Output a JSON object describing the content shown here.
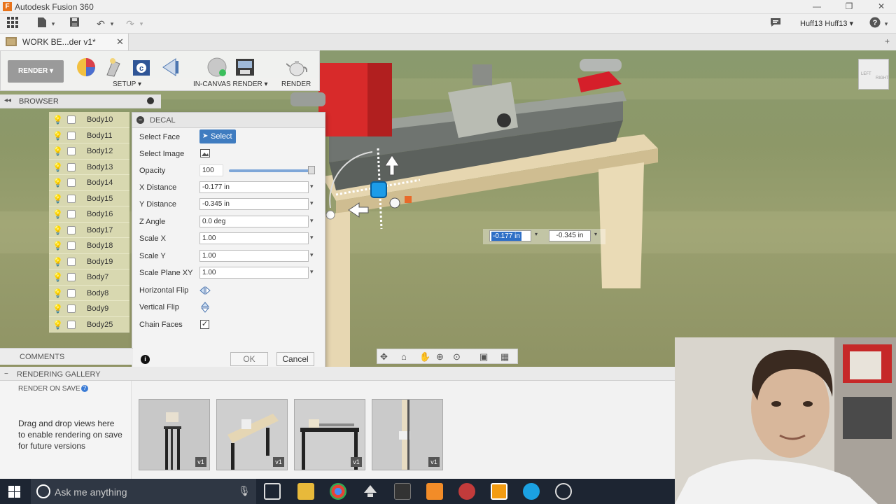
{
  "window": {
    "title": "Autodesk Fusion 360",
    "logo_letter": "F"
  },
  "app_toolbar": {
    "user": "Huff13 Huff13"
  },
  "document_tab": {
    "name": "WORK BE...der v1*"
  },
  "ribbon": {
    "workspace": "RENDER",
    "setup_label": "SETUP",
    "in_canvas_label": "IN-CANVAS RENDER",
    "render_label": "RENDER"
  },
  "browser": {
    "title": "BROWSER",
    "bodies": [
      "Body10",
      "Body11",
      "Body12",
      "Body13",
      "Body14",
      "Body15",
      "Body16",
      "Body17",
      "Body18",
      "Body19",
      "Body7",
      "Body8",
      "Body9",
      "Body25"
    ]
  },
  "decal": {
    "title": "DECAL",
    "select_face_label": "Select Face",
    "select_button": "Select",
    "select_image_label": "Select Image",
    "opacity_label": "Opacity",
    "opacity_value": "100",
    "x_distance_label": "X Distance",
    "x_distance_value": "-0.177 in",
    "y_distance_label": "Y Distance",
    "y_distance_value": "-0.345 in",
    "z_angle_label": "Z Angle",
    "z_angle_value": "0.0 deg",
    "scale_x_label": "Scale X",
    "scale_x_value": "1.00",
    "scale_y_label": "Scale Y",
    "scale_y_value": "1.00",
    "scale_plane_label": "Scale Plane XY",
    "scale_plane_value": "1.00",
    "hflip_label": "Horizontal Flip",
    "vflip_label": "Vertical Flip",
    "chain_faces_label": "Chain Faces",
    "ok": "OK",
    "cancel": "Cancel"
  },
  "canvas_inputs": {
    "x": "-0.177 in",
    "y": "-0.345 in"
  },
  "viewcube": {
    "face1": "LEFT",
    "face2": "RIGHT"
  },
  "comments": {
    "title": "COMMENTS"
  },
  "gallery": {
    "title": "RENDERING GALLERY",
    "render_on_save": "RENDER ON SAVE",
    "hint": "Drag and drop views here to enable rendering on save for future versions",
    "thumbs": [
      "v1",
      "v1",
      "v1",
      "v1"
    ]
  },
  "taskbar": {
    "search_placeholder": "Ask me anything"
  }
}
